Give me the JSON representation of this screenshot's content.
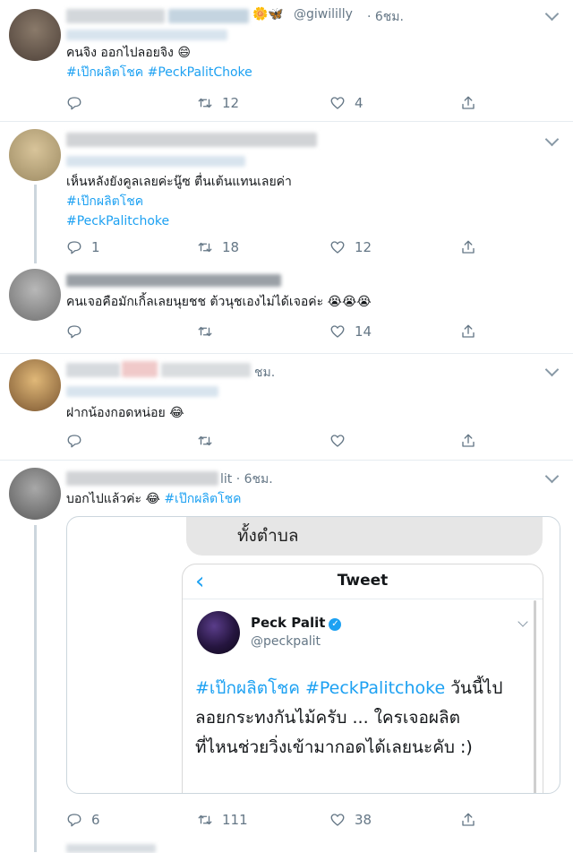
{
  "tweets": [
    {
      "handle": "@giwililly",
      "time": "· 6ชม.",
      "emoji": "🌼🦋",
      "lines": [
        [
          {
            "t": "คนจิง ออกไปลอยจิง 😄",
            "tag": false
          }
        ],
        [
          {
            "t": "#เป๊กผลิตโชค",
            "tag": true
          },
          {
            "t": " ",
            "tag": false
          },
          {
            "t": "#PeckPalitChoke",
            "tag": true
          }
        ]
      ],
      "reply": "",
      "retweet": "12",
      "like": "4"
    },
    {
      "lines": [
        [
          {
            "t": "เห็นหลังยังคูลเลยค่ะนู๊ซ ตื่นเต้นแทนเลยค่า",
            "tag": false
          }
        ],
        [
          {
            "t": "#เป๊กผลิตโชค",
            "tag": true
          }
        ],
        [
          {
            "t": "#PeckPalitchoke",
            "tag": true
          }
        ]
      ],
      "reply": "1",
      "retweet": "18",
      "like": "12"
    },
    {
      "lines": [
        [
          {
            "t": "คนเจอคือมักเกิ้ลเลยนุยชช ต้วนุชเองไม่ได้เจอค่ะ 😭😭😭",
            "tag": false
          }
        ]
      ],
      "reply": "",
      "retweet": "",
      "like": "14"
    },
    {
      "time": "ชม.",
      "lines": [
        [
          {
            "t": "ฝากน้องกอดหน่อย 😂",
            "tag": false
          }
        ]
      ],
      "reply": "",
      "retweet": "",
      "like": ""
    },
    {
      "time": "lit · 6ชม.",
      "lines": [
        [
          {
            "t": "บอกไปแล้วค่ะ 😂 ",
            "tag": false
          },
          {
            "t": "#เป๊กผลิตโชค",
            "tag": true
          }
        ]
      ],
      "reply": "6",
      "retweet": "111",
      "like": "38"
    }
  ],
  "embed": {
    "bubble_text": "ทั้งตำบล",
    "back_icon": "‹",
    "screen_title": "Tweet",
    "name": "Peck Palit",
    "verified": "✓",
    "handle": "@peckpalit",
    "text_lines": [
      [
        {
          "t": "#เป๊กผลิตโชค",
          "tag": true
        },
        {
          "t": " ",
          "tag": false
        },
        {
          "t": "#PeckPalitchoke",
          "tag": true
        },
        {
          "t": " วันนี้ไป",
          "tag": false
        }
      ],
      [
        {
          "t": "ลอยกระทงกันไม้ครับ ... ใครเจอผลิต",
          "tag": false
        }
      ],
      [
        {
          "t": "ที่ไหนช่วยวิ่งเข้ามากอดได้เลยนะคับ :)",
          "tag": false
        }
      ]
    ]
  },
  "icons": {
    "reply": "reply-icon",
    "retweet": "retweet-icon",
    "like": "heart-icon",
    "share": "share-icon",
    "menu": "chevron-down-icon"
  },
  "colors": {
    "link": "#1da1f2",
    "muted": "#657786",
    "border": "#e6ecf0"
  }
}
